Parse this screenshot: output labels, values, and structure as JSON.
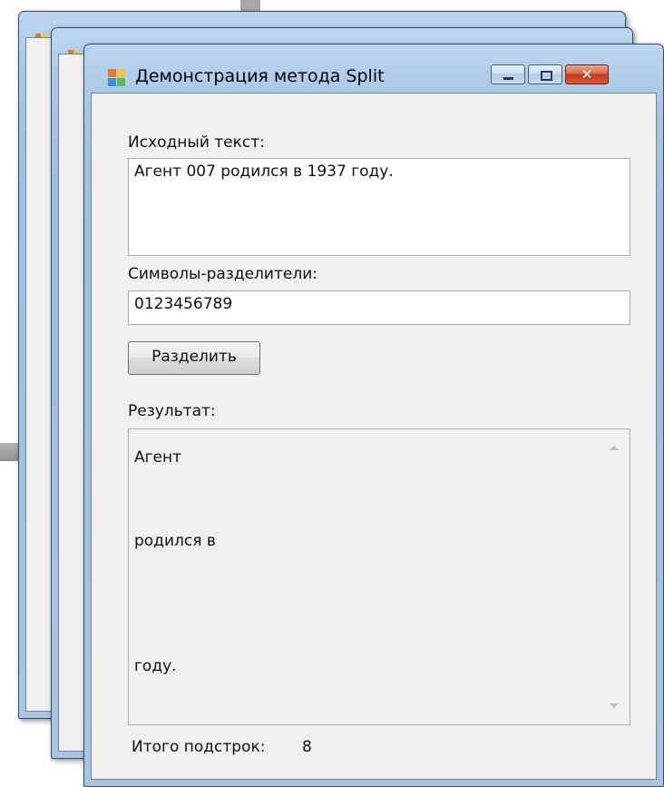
{
  "window": {
    "title": "Демонстрация метода Split",
    "minimize_glyph": "",
    "close_glyph": "✕"
  },
  "source": {
    "label": "Исходный текст:",
    "value": "Агент 007 родился в 1937 году."
  },
  "separators": {
    "label": "Символы-разделители:",
    "value": "0123456789"
  },
  "split_button": {
    "label": "Разделить"
  },
  "result": {
    "label": "Результат:",
    "lines": [
      "Агент",
      "",
      "родился в",
      "",
      "",
      "году.",
      "",
      ""
    ]
  },
  "total": {
    "label": "Итого подстрок:",
    "value": "8"
  }
}
